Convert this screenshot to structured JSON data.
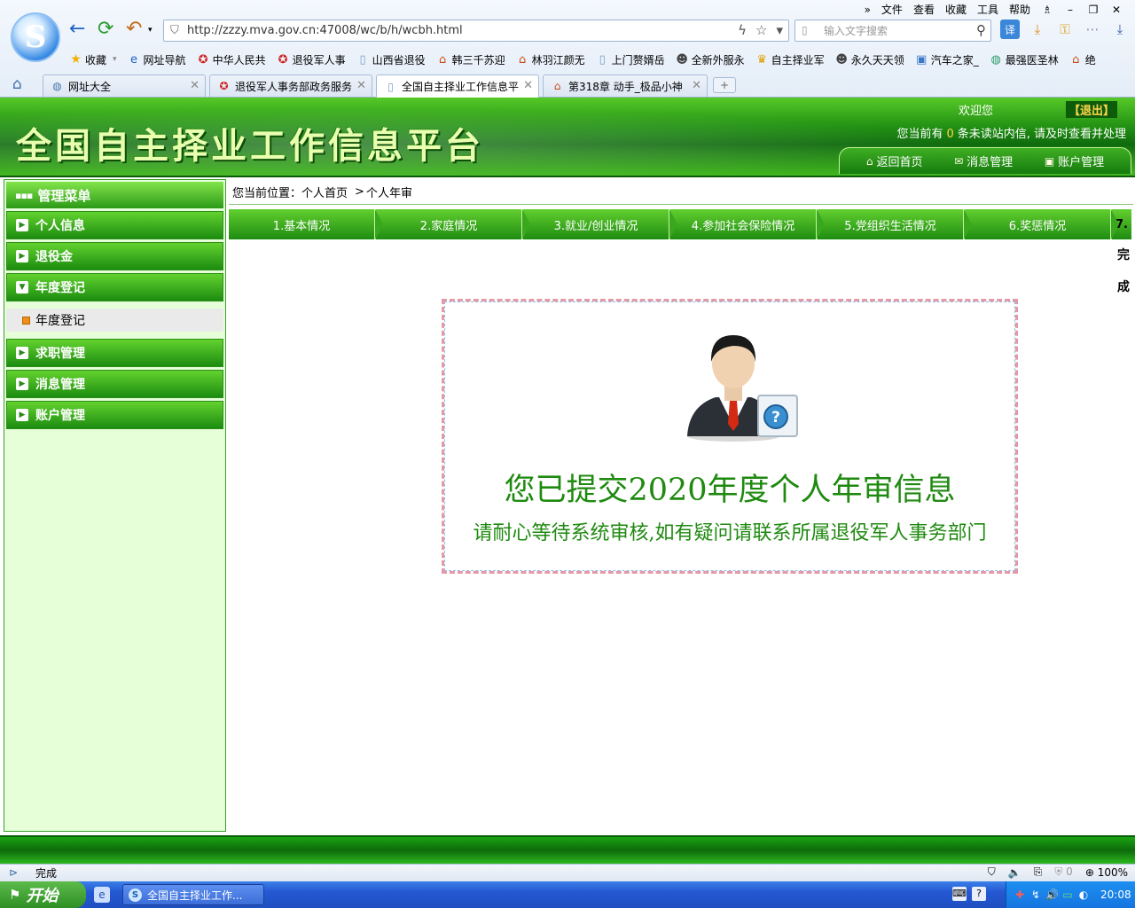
{
  "browser": {
    "menu": [
      "文件",
      "查看",
      "收藏",
      "工具",
      "帮助"
    ],
    "menu_more": "»",
    "address": "http://zzzy.mva.gov.cn:47008/wc/b/h/wcbh.html",
    "search_placeholder": "输入文字搜索",
    "favorites_label": "收藏",
    "favorites": [
      {
        "label": "网址导航",
        "icon": "ie-icon",
        "color": "#1d63c4"
      },
      {
        "label": "中华人民共",
        "icon": "emblem-icon",
        "color": "#d02020"
      },
      {
        "label": "退役军人事",
        "icon": "emblem-icon",
        "color": "#d02020"
      },
      {
        "label": "山西省退役",
        "icon": "page-icon",
        "color": "#7a9cc6"
      },
      {
        "label": "韩三千苏迎",
        "icon": "house-icon",
        "color": "#c84a12"
      },
      {
        "label": "林羽江颜无",
        "icon": "house-icon",
        "color": "#c84a12"
      },
      {
        "label": "上门赘婿岳",
        "icon": "page-icon",
        "color": "#7a9cc6"
      },
      {
        "label": "全新外服永",
        "icon": "game-icon",
        "color": "#444444"
      },
      {
        "label": "自主择业军",
        "icon": "trophy-icon",
        "color": "#e0a000"
      },
      {
        "label": "永久天天领",
        "icon": "game-icon",
        "color": "#444444"
      },
      {
        "label": "汽车之家_",
        "icon": "car-icon",
        "color": "#3a78c8"
      },
      {
        "label": "最强医圣林",
        "icon": "globe-icon",
        "color": "#2a9a6a"
      },
      {
        "label": "绝",
        "icon": "house-icon",
        "color": "#c84a12"
      }
    ],
    "tabs": [
      {
        "title": "网址大全",
        "icon": "globe-icon",
        "active": false
      },
      {
        "title": "退役军人事务部政务服务",
        "icon": "emblem-icon",
        "active": false
      },
      {
        "title": "全国自主择业工作信息平",
        "icon": "page-icon",
        "active": true
      },
      {
        "title": "第318章 动手_极品小神",
        "icon": "house-icon",
        "active": false
      }
    ],
    "tab_add": "+",
    "status_text": "完成",
    "zoom": "100%",
    "blocked_count": "0"
  },
  "site": {
    "title": "全国自主择业工作信息平台",
    "welcome": "欢迎您",
    "username": "",
    "logout": "【退出】",
    "notice_prefix": "您当前有",
    "notice_count": "0",
    "notice_suffix": "条未读站内信, 请及时查看并处理",
    "header_nav": [
      {
        "label": "返回首页",
        "icon": "home-icon"
      },
      {
        "label": "消息管理",
        "icon": "mail-icon"
      },
      {
        "label": "账户管理",
        "icon": "account-icon"
      }
    ]
  },
  "sidebar": {
    "title": "管理菜单",
    "items_top": [
      {
        "label": "个人信息",
        "expanded": false
      },
      {
        "label": "退役金",
        "expanded": false
      },
      {
        "label": "年度登记",
        "expanded": true
      }
    ],
    "sub_item": "年度登记",
    "items_bottom": [
      {
        "label": "求职管理"
      },
      {
        "label": "消息管理"
      },
      {
        "label": "账户管理"
      }
    ]
  },
  "breadcrumb": {
    "prefix": "您当前位置：",
    "home": "个人首页",
    "sep": ">",
    "current": "个人年审"
  },
  "steps": [
    "1.基本情况",
    "2.家庭情况",
    "3.就业/创业情况",
    "4.参加社会保险情况",
    "5.党组织生活情况",
    "6.奖惩情况"
  ],
  "step_last": {
    "num": "7.",
    "text_1": "完",
    "text_2": "成"
  },
  "notice": {
    "title": "您已提交2020年度个人年审信息",
    "subtitle": "请耐心等待系统审核,如有疑问请联系所属退役军人事务部门"
  },
  "taskbar": {
    "start": "开始",
    "task_title": "全国自主择业工作...",
    "clock": "20:08"
  },
  "colors": {
    "brand_green": "#1f8d12",
    "title_yellow": "#e8ffb0",
    "accent_yellow": "#ffd54a",
    "notice_text": "#1f8a10"
  }
}
